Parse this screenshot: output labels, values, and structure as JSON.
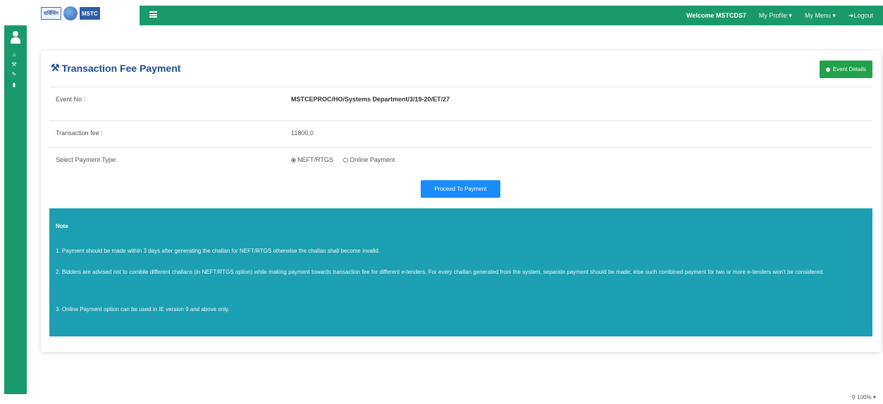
{
  "header": {
    "logo_left_text": "सर्विसिंग",
    "logo_right_text": "MSTC",
    "welcome": "Welcome MSTCDS7",
    "my_profile": "My Profile ▾",
    "my_menu": "My Menu ▾",
    "logout": "Logout",
    "accent": "#1a9a6c"
  },
  "sidebar": {
    "icons": [
      "user-icon",
      "home-icon",
      "gavel-icon",
      "graduation-cap-icon",
      "bar-chart-icon"
    ]
  },
  "card": {
    "title": "Transaction Fee Payment",
    "event_details_button": "Event Details",
    "rows": [
      {
        "label": "Event No :",
        "value": "MSTCEPROC/HO/Systems Department/3/19-20/ET/27"
      },
      {
        "label": "Transaction fee :",
        "value": "11800.0"
      },
      {
        "label": "Select Payment Type:",
        "options": [
          "NEFT/RTGS",
          "Online Payment"
        ],
        "selected": "NEFT/RTGS"
      }
    ],
    "proceed_button": "Proceed To Payment"
  },
  "note": {
    "title": "Note",
    "items": [
      "1. Payment should be made within 3 days after generating the challan for NEFT/RTGS otherwise the challan shall become invalid.",
      "2. Bidders are advised not to combile different challans (in NEFT/RTGS option) while making payment towards transaction fee for different e-tenders. For every challan generated from the system, separate payment should be made; else such combined payment for two or more e-tenders won't be considered.",
      "3. Online Payment option can be used in IE version 9 and above only."
    ],
    "color": "#1c9fb2"
  },
  "status": {
    "zoom": "100%"
  }
}
